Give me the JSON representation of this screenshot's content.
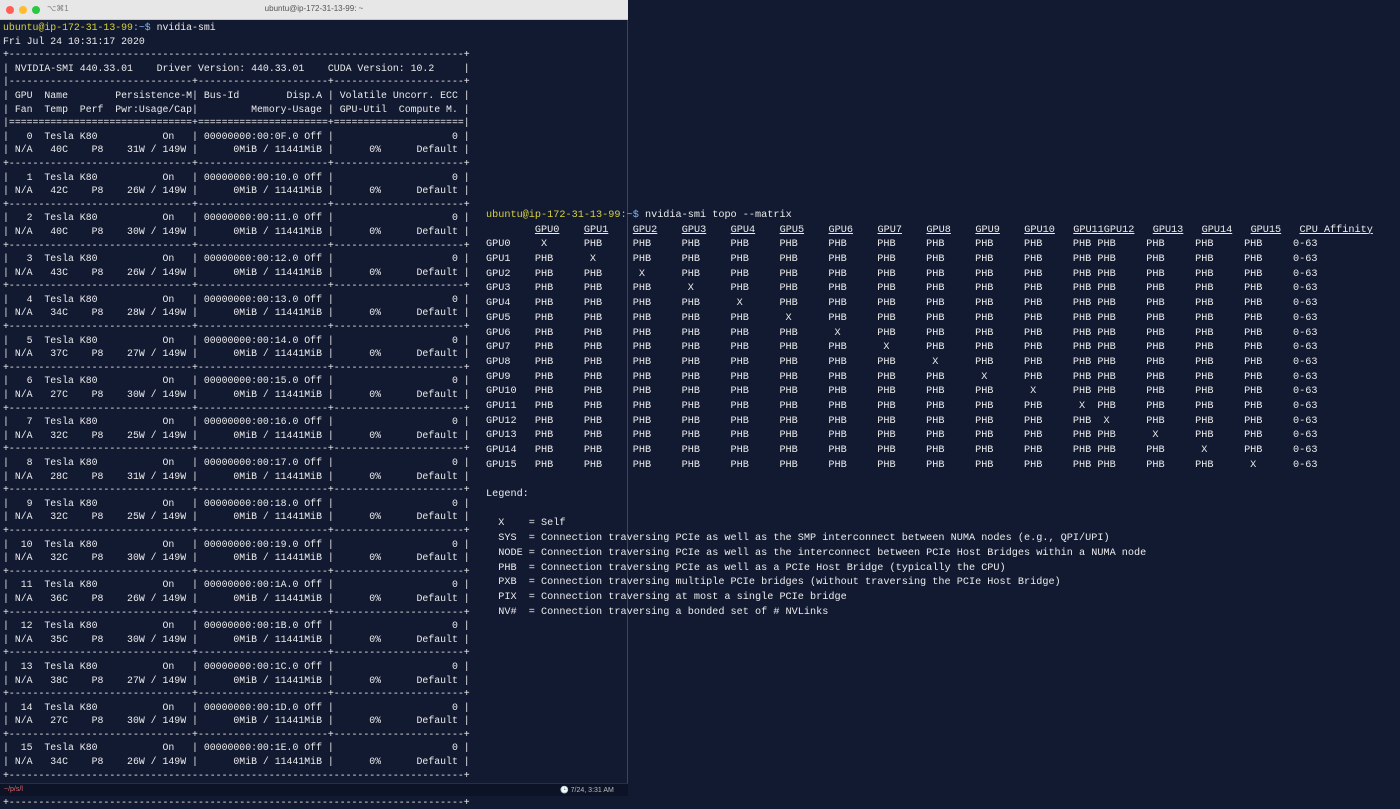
{
  "window": {
    "shortcut": "⌥⌘1",
    "title": "ubuntu@ip-172-31-13-99: ~"
  },
  "prompt": {
    "user_host": "ubuntu@ip-172-31-13-99",
    "path": ":~$ "
  },
  "smi": {
    "command": "nvidia-smi",
    "timestamp": "Fri Jul 24 10:31:17 2020",
    "border": "+-----------------------------------------------------------------------------+",
    "version_line": "| NVIDIA-SMI 440.33.01    Driver Version: 440.33.01    CUDA Version: 10.2     |",
    "header_sep": "|-------------------------------+----------------------+----------------------+",
    "header_1": "| GPU  Name        Persistence-M| Bus-Id        Disp.A | Volatile Uncorr. ECC |",
    "header_2": "| Fan  Temp  Perf  Pwr:Usage/Cap|         Memory-Usage | GPU-Util  Compute M. |",
    "header_end": "|===============================+======================+======================|",
    "row_sep": "+-------------------------------+----------------------+----------------------+",
    "gpus": [
      {
        "line1": "|   0  Tesla K80           On   | 00000000:00:0F.0 Off |                    0 |",
        "line2": "| N/A   40C    P8    31W / 149W |      0MiB / 11441MiB |      0%      Default |"
      },
      {
        "line1": "|   1  Tesla K80           On   | 00000000:00:10.0 Off |                    0 |",
        "line2": "| N/A   42C    P8    26W / 149W |      0MiB / 11441MiB |      0%      Default |"
      },
      {
        "line1": "|   2  Tesla K80           On   | 00000000:00:11.0 Off |                    0 |",
        "line2": "| N/A   40C    P8    30W / 149W |      0MiB / 11441MiB |      0%      Default |"
      },
      {
        "line1": "|   3  Tesla K80           On   | 00000000:00:12.0 Off |                    0 |",
        "line2": "| N/A   43C    P8    26W / 149W |      0MiB / 11441MiB |      0%      Default |"
      },
      {
        "line1": "|   4  Tesla K80           On   | 00000000:00:13.0 Off |                    0 |",
        "line2": "| N/A   34C    P8    28W / 149W |      0MiB / 11441MiB |      0%      Default |"
      },
      {
        "line1": "|   5  Tesla K80           On   | 00000000:00:14.0 Off |                    0 |",
        "line2": "| N/A   37C    P8    27W / 149W |      0MiB / 11441MiB |      0%      Default |"
      },
      {
        "line1": "|   6  Tesla K80           On   | 00000000:00:15.0 Off |                    0 |",
        "line2": "| N/A   27C    P8    30W / 149W |      0MiB / 11441MiB |      0%      Default |"
      },
      {
        "line1": "|   7  Tesla K80           On   | 00000000:00:16.0 Off |                    0 |",
        "line2": "| N/A   32C    P8    25W / 149W |      0MiB / 11441MiB |      0%      Default |"
      },
      {
        "line1": "|   8  Tesla K80           On   | 00000000:00:17.0 Off |                    0 |",
        "line2": "| N/A   28C    P8    31W / 149W |      0MiB / 11441MiB |      0%      Default |"
      },
      {
        "line1": "|   9  Tesla K80           On   | 00000000:00:18.0 Off |                    0 |",
        "line2": "| N/A   32C    P8    25W / 149W |      0MiB / 11441MiB |      0%      Default |"
      },
      {
        "line1": "|  10  Tesla K80           On   | 00000000:00:19.0 Off |                    0 |",
        "line2": "| N/A   32C    P8    30W / 149W |      0MiB / 11441MiB |      0%      Default |"
      },
      {
        "line1": "|  11  Tesla K80           On   | 00000000:00:1A.0 Off |                    0 |",
        "line2": "| N/A   36C    P8    26W / 149W |      0MiB / 11441MiB |      0%      Default |"
      },
      {
        "line1": "|  12  Tesla K80           On   | 00000000:00:1B.0 Off |                    0 |",
        "line2": "| N/A   35C    P8    30W / 149W |      0MiB / 11441MiB |      0%      Default |"
      },
      {
        "line1": "|  13  Tesla K80           On   | 00000000:00:1C.0 Off |                    0 |",
        "line2": "| N/A   38C    P8    27W / 149W |      0MiB / 11441MiB |      0%      Default |"
      },
      {
        "line1": "|  14  Tesla K80           On   | 00000000:00:1D.0 Off |                    0 |",
        "line2": "| N/A   27C    P8    30W / 149W |      0MiB / 11441MiB |      0%      Default |"
      },
      {
        "line1": "|  15  Tesla K80           On   | 00000000:00:1E.0 Off |                    0 |",
        "line2": "| N/A   34C    P8    26W / 149W |      0MiB / 11441MiB |      0%      Default |"
      }
    ]
  },
  "topo": {
    "command": "nvidia-smi topo --matrix",
    "lead": "        ",
    "headers": [
      {
        "text": "GPU0",
        "pad": "    "
      },
      {
        "text": "GPU1",
        "pad": "    "
      },
      {
        "text": "GPU2",
        "pad": "    "
      },
      {
        "text": "GPU3",
        "pad": "    "
      },
      {
        "text": "GPU4",
        "pad": "    "
      },
      {
        "text": "GPU5",
        "pad": "    "
      },
      {
        "text": "GPU6",
        "pad": "    "
      },
      {
        "text": "GPU7",
        "pad": "    "
      },
      {
        "text": "GPU8",
        "pad": "    "
      },
      {
        "text": "GPU9",
        "pad": "    "
      },
      {
        "text": "GPU10",
        "pad": "   "
      },
      {
        "text": "GPU11",
        "pad": ""
      },
      {
        "text": "GPU12",
        "pad": "   "
      },
      {
        "text": "GPU13",
        "pad": "   "
      },
      {
        "text": "GPU14",
        "pad": "   "
      },
      {
        "text": "GPU15",
        "pad": "   "
      },
      {
        "text": "CPU Affinity",
        "pad": ""
      }
    ],
    "rows": [
      "GPU0     X      PHB     PHB     PHB     PHB     PHB     PHB     PHB     PHB     PHB     PHB     PHB PHB     PHB     PHB     PHB     0-63",
      "GPU1    PHB      X      PHB     PHB     PHB     PHB     PHB     PHB     PHB     PHB     PHB     PHB PHB     PHB     PHB     PHB     0-63",
      "GPU2    PHB     PHB      X      PHB     PHB     PHB     PHB     PHB     PHB     PHB     PHB     PHB PHB     PHB     PHB     PHB     0-63",
      "GPU3    PHB     PHB     PHB      X      PHB     PHB     PHB     PHB     PHB     PHB     PHB     PHB PHB     PHB     PHB     PHB     0-63",
      "GPU4    PHB     PHB     PHB     PHB      X      PHB     PHB     PHB     PHB     PHB     PHB     PHB PHB     PHB     PHB     PHB     0-63",
      "GPU5    PHB     PHB     PHB     PHB     PHB      X      PHB     PHB     PHB     PHB     PHB     PHB PHB     PHB     PHB     PHB     0-63",
      "GPU6    PHB     PHB     PHB     PHB     PHB     PHB      X      PHB     PHB     PHB     PHB     PHB PHB     PHB     PHB     PHB     0-63",
      "GPU7    PHB     PHB     PHB     PHB     PHB     PHB     PHB      X      PHB     PHB     PHB     PHB PHB     PHB     PHB     PHB     0-63",
      "GPU8    PHB     PHB     PHB     PHB     PHB     PHB     PHB     PHB      X      PHB     PHB     PHB PHB     PHB     PHB     PHB     0-63",
      "GPU9    PHB     PHB     PHB     PHB     PHB     PHB     PHB     PHB     PHB      X      PHB     PHB PHB     PHB     PHB     PHB     0-63",
      "GPU10   PHB     PHB     PHB     PHB     PHB     PHB     PHB     PHB     PHB     PHB      X      PHB PHB     PHB     PHB     PHB     0-63",
      "GPU11   PHB     PHB     PHB     PHB     PHB     PHB     PHB     PHB     PHB     PHB     PHB      X  PHB     PHB     PHB     PHB     0-63",
      "GPU12   PHB     PHB     PHB     PHB     PHB     PHB     PHB     PHB     PHB     PHB     PHB     PHB  X      PHB     PHB     PHB     0-63",
      "GPU13   PHB     PHB     PHB     PHB     PHB     PHB     PHB     PHB     PHB     PHB     PHB     PHB PHB      X      PHB     PHB     0-63",
      "GPU14   PHB     PHB     PHB     PHB     PHB     PHB     PHB     PHB     PHB     PHB     PHB     PHB PHB     PHB      X      PHB     0-63",
      "GPU15   PHB     PHB     PHB     PHB     PHB     PHB     PHB     PHB     PHB     PHB     PHB     PHB PHB     PHB     PHB      X      0-63"
    ],
    "legend_title": "Legend:",
    "legend": [
      "  X    = Self",
      "  SYS  = Connection traversing PCIe as well as the SMP interconnect between NUMA nodes (e.g., QPI/UPI)",
      "  NODE = Connection traversing PCIe as well as the interconnect between PCIe Host Bridges within a NUMA node",
      "  PHB  = Connection traversing PCIe as well as a PCIe Host Bridge (typically the CPU)",
      "  PXB  = Connection traversing multiple PCIe bridges (without traversing the PCIe Host Bridge)",
      "  PIX  = Connection traversing at most a single PCIe bridge",
      "  NV#  = Connection traversing a bonded set of # NVLinks"
    ]
  },
  "statusbar": {
    "folder": "~/p/s/l",
    "clock": "🕒 7/24, 3:31 AM"
  }
}
